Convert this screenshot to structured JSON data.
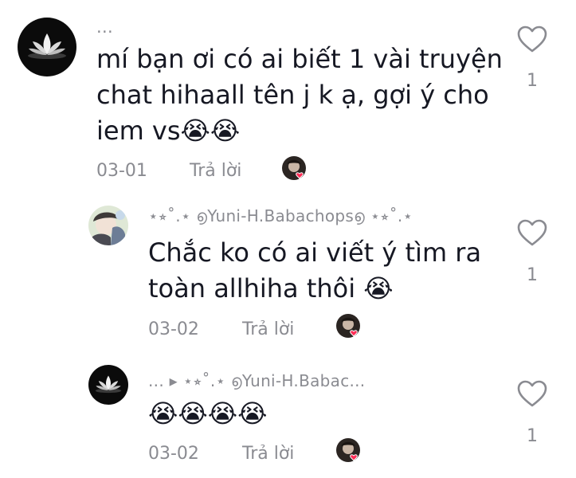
{
  "comments": [
    {
      "username": "...",
      "text": "mí bạn ơi có ai biết 1 vài truyện\nchat hihaall tên j k ạ, gợi ý cho\niem vs😭😭",
      "date": "03-01",
      "reply_label": "Trả lời",
      "like_count": "1",
      "avatar_icon": "lotus-avatar"
    },
    {
      "username": "⋆⭒˚.⋆ ൭Yuni-H.Babachops൭ ⋆⭒˚.⋆",
      "text": "Chắc ko có ai viết ý tìm ra\ntoàn allhiha thôi 😭",
      "date": "03-02",
      "reply_label": "Trả lời",
      "like_count": "1",
      "avatar_icon": "anime-avatar"
    },
    {
      "username": "... ▸ ⋆⭒˚.⋆ ൭Yuni-H.Babac...",
      "text": "😭😭😭😭",
      "date": "03-02",
      "reply_label": "Trả lời",
      "like_count": "1",
      "avatar_icon": "lotus-avatar"
    }
  ],
  "colors": {
    "muted": "#8a8b91",
    "text": "#161823",
    "heart_badge": "#fe2c55"
  }
}
